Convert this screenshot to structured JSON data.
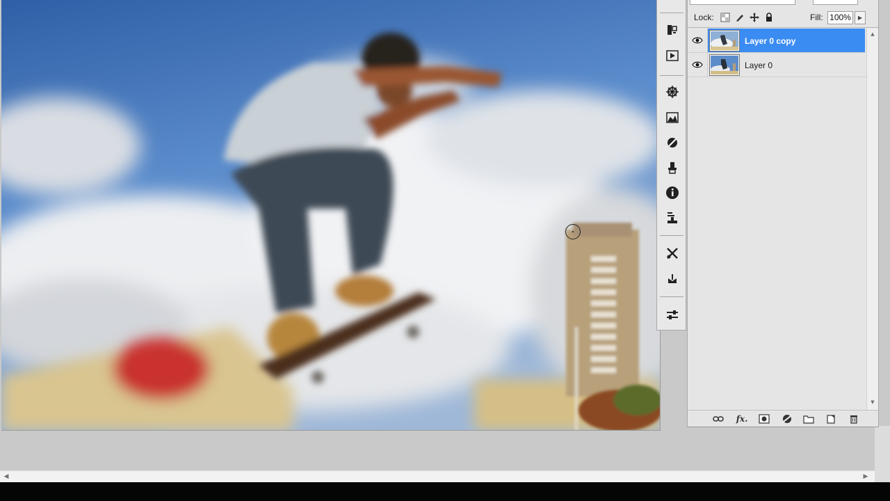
{
  "layers_panel": {
    "lock_label": "Lock:",
    "fill_label": "Fill:",
    "fill_value": "100%",
    "layers": [
      {
        "name": "Layer 0 copy",
        "selected": true,
        "visible": true
      },
      {
        "name": "Layer 0",
        "selected": false,
        "visible": true
      }
    ],
    "footer_buttons": [
      "link-layers",
      "layer-style",
      "add-mask",
      "new-adjustment-layer",
      "new-group",
      "new-layer",
      "delete-layer"
    ],
    "fx_label": "fx."
  },
  "dock_tools": [
    "history-icon",
    "actions-icon",
    "navigator-icon",
    "histogram-icon",
    "adjustments-icon",
    "clone-source-icon",
    "info-icon",
    "stamp-icon",
    "tool-presets-icon",
    "brushes-icon",
    "character-icon"
  ],
  "colors": {
    "selection": "#3b8cf2",
    "panel_bg": "#e5e5e5",
    "workspace_bg": "#c9c9c9"
  }
}
